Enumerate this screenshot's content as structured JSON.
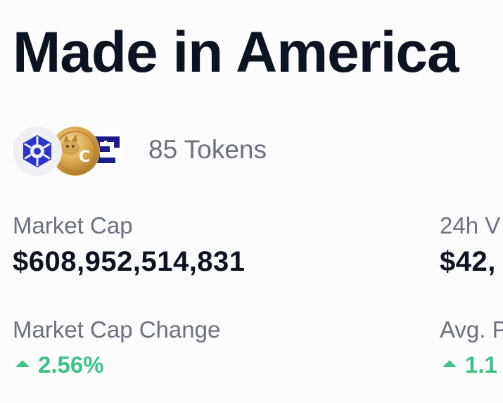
{
  "header": {
    "title": "Made in America"
  },
  "tokens": {
    "count_label": "85 Tokens",
    "icons": [
      "hexagon-token-icon",
      "coin-token-icon",
      "pixel-token-icon"
    ],
    "coin_letter": "C"
  },
  "stats": {
    "market_cap": {
      "label": "Market Cap",
      "value": "$608,952,514,831"
    },
    "volume_24h": {
      "label": "24h V",
      "value": "$42,"
    },
    "market_cap_change": {
      "label": "Market Cap Change",
      "value": "2.56%",
      "direction": "up"
    },
    "avg_change": {
      "label": "Avg. P",
      "value": "1.1",
      "direction": "up"
    }
  },
  "colors": {
    "text_primary": "#0d1421",
    "text_secondary": "#6b717d",
    "positive": "#3dc389",
    "hex_logo": "#2b35c9",
    "pixel_logo": "#1c1c8c"
  }
}
